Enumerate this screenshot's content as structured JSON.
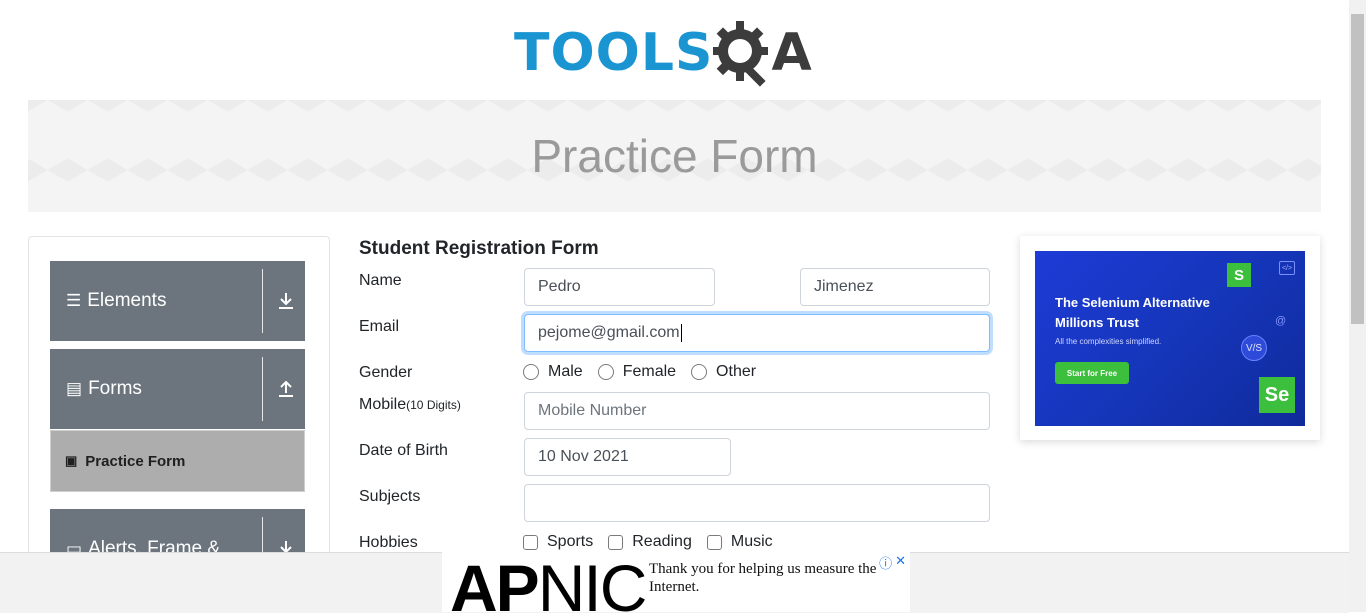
{
  "logo": {
    "text_tools": "TOOLS",
    "text_qa": "A"
  },
  "banner": {
    "title": "Practice Form"
  },
  "sidebar": {
    "groups": [
      {
        "label": "Elements",
        "icon": "hamburger-icon",
        "arrow": "download-arrow-icon"
      },
      {
        "label": "Forms",
        "icon": "document-icon",
        "arrow": "upload-arrow-icon"
      },
      {
        "label": "Alerts, Frame &",
        "icon": "window-icon",
        "arrow": "download-arrow-icon"
      }
    ],
    "active_item": "Practice Form"
  },
  "form": {
    "title": "Student Registration Form",
    "name_label": "Name",
    "first_name": "Pedro",
    "last_name": "Jimenez",
    "email_label": "Email",
    "email_value": "pejome@gmail.com",
    "gender_label": "Gender",
    "gender_options": [
      "Male",
      "Female",
      "Other"
    ],
    "mobile_label": "Mobile",
    "mobile_hint": "(10 Digits)",
    "mobile_placeholder": "Mobile Number",
    "dob_label": "Date of Birth",
    "dob_value": "10 Nov 2021",
    "subjects_label": "Subjects",
    "subjects_value": "",
    "hobbies_label": "Hobbies",
    "hobbies_options": [
      "Sports",
      "Reading",
      "Music"
    ]
  },
  "side_ad": {
    "headline_1": "The Selenium Alternative",
    "headline_2": "Millions Trust",
    "subline": "All the complexities simplified.",
    "button": "Start for Free",
    "badge_s": "S",
    "badge_se": "Se",
    "badge_vs": "V/S"
  },
  "bottom_ad": {
    "brand_ap": "AP",
    "brand_nic": "NIC",
    "message": "Thank you for helping us measure the Internet.",
    "info": "ⓘ",
    "close": "✕"
  },
  "colors": {
    "brand_blue": "#1b95d2",
    "sidebar_gray": "#6c757d",
    "active_gray": "#adadad",
    "focus_blue": "#80bdff"
  }
}
